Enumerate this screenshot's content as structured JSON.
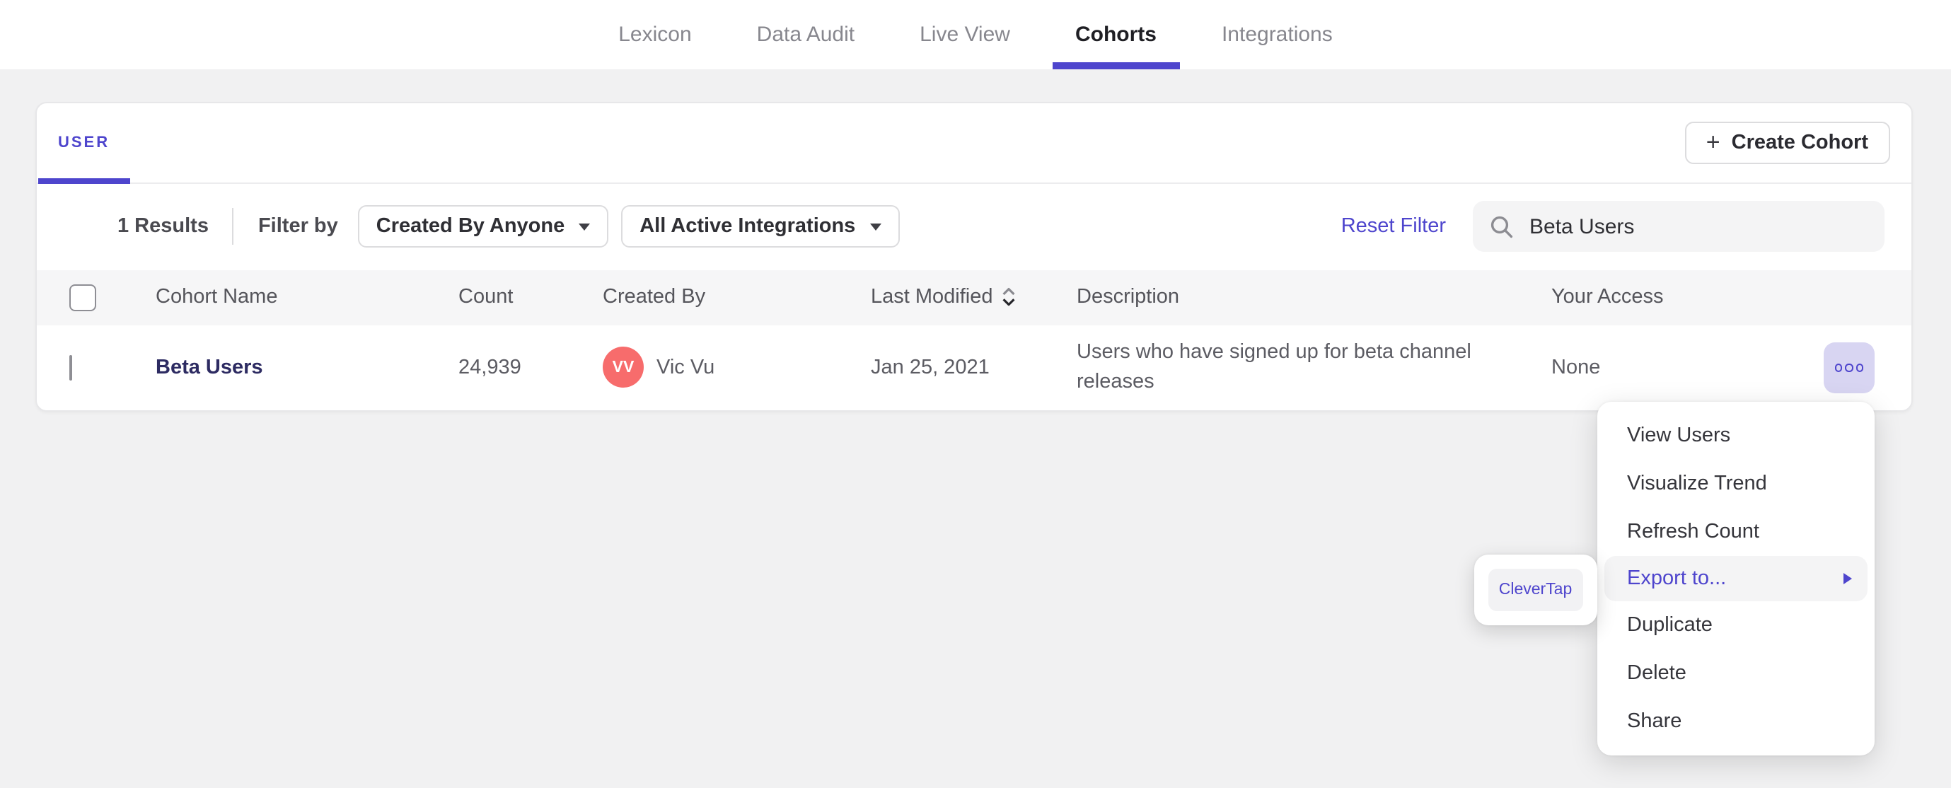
{
  "ui_colors": {
    "accent_purple": "#4e45cd",
    "page_background": "#f1f1f2",
    "avatar_coral": "#f76c6c",
    "dots_button_background": "#d8d5f2"
  },
  "nav": {
    "tabs": [
      {
        "label": "Lexicon",
        "active": false
      },
      {
        "label": "Data Audit",
        "active": false
      },
      {
        "label": "Live View",
        "active": false
      },
      {
        "label": "Cohorts",
        "active": true
      },
      {
        "label": "Integrations",
        "active": false
      }
    ]
  },
  "panel": {
    "tab_label": "USER",
    "create_button": {
      "plus": "+",
      "label": "Create Cohort"
    },
    "filters": {
      "results_count": "1 Results",
      "filter_by_label": "Filter by",
      "dropdowns": [
        {
          "value": "Created By Anyone"
        },
        {
          "value": "All Active Integrations"
        }
      ],
      "reset_label": "Reset Filter",
      "search_value": "Beta Users"
    },
    "table": {
      "headers": {
        "cohort_name": "Cohort Name",
        "count": "Count",
        "created_by": "Created By",
        "last_modified": "Last Modified",
        "description": "Description",
        "your_access": "Your Access"
      },
      "rows": [
        {
          "cohort_name": "Beta Users",
          "count": "24,939",
          "created_by": "Vic Vu",
          "avatar_initials": "VV",
          "avatar_color": "#f76c6c",
          "last_modified": "Jan 25, 2021",
          "description": "Users who have signed up for beta channel releases",
          "your_access": "None"
        }
      ]
    }
  },
  "context_menu": {
    "items": [
      {
        "label": "View Users",
        "highlighted": false,
        "has_submenu": false
      },
      {
        "label": "Visualize Trend",
        "highlighted": false,
        "has_submenu": false
      },
      {
        "label": "Refresh Count",
        "highlighted": false,
        "has_submenu": false
      },
      {
        "label": "Export to...",
        "highlighted": true,
        "has_submenu": true
      },
      {
        "label": "Duplicate",
        "highlighted": false,
        "has_submenu": false
      },
      {
        "label": "Delete",
        "highlighted": false,
        "has_submenu": false
      },
      {
        "label": "Share",
        "highlighted": false,
        "has_submenu": false
      }
    ]
  },
  "export_submenu": {
    "items": [
      {
        "label": "CleverTap"
      }
    ]
  }
}
